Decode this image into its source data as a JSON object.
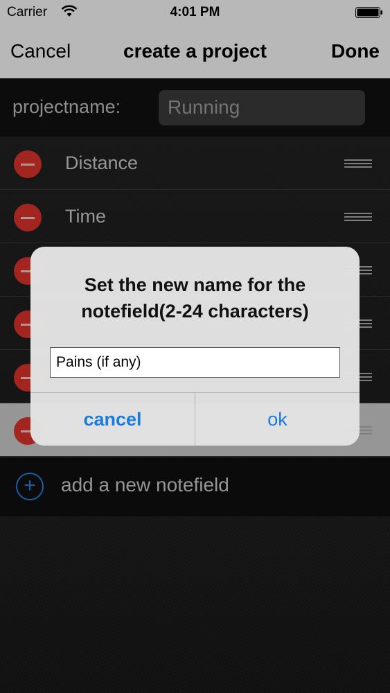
{
  "status_bar": {
    "carrier": "Carrier",
    "time": "4:01 PM"
  },
  "navbar": {
    "cancel_label": "Cancel",
    "title": "create a project",
    "done_label": "Done"
  },
  "project": {
    "label": "projectname:",
    "name_value": "Running"
  },
  "notefields": [
    {
      "name": "Distance"
    },
    {
      "name": "Time"
    },
    {
      "name": ""
    },
    {
      "name": ""
    },
    {
      "name": ""
    },
    {
      "name": ""
    }
  ],
  "add_row": {
    "label": "add a new notefield"
  },
  "alert": {
    "message": "Set the new name for the notefield(2-24 characters)",
    "field_value": "Pains (if any)",
    "cancel_label": "cancel",
    "ok_label": "ok"
  },
  "colors": {
    "accent": "#1a7be0",
    "delete": "#d9332a"
  }
}
